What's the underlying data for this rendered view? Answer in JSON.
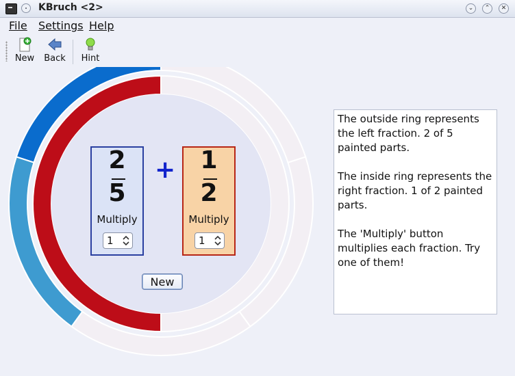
{
  "window": {
    "title": "KBruch <2>"
  },
  "menu": {
    "file": "File",
    "settings": "Settings",
    "help": "Help"
  },
  "toolbar": {
    "new_label": "New",
    "back_label": "Back",
    "hint_label": "Hint"
  },
  "exercise": {
    "left": {
      "numerator": "2",
      "denominator": "5",
      "multiply_label": "Multiply",
      "multiplier": "1",
      "color": "#dbe3f6",
      "border": "#2a3fa0"
    },
    "operator": "+",
    "right": {
      "numerator": "1",
      "denominator": "2",
      "multiply_label": "Multiply",
      "multiplier": "1",
      "color": "#f8d3a6",
      "border": "#b72515"
    },
    "new_button": "New"
  },
  "rings": {
    "outer": {
      "parts": 5,
      "painted": 2,
      "colors": [
        "#0a6ccd",
        "#3e9bd0"
      ],
      "empty": "#f3eff4"
    },
    "inner": {
      "parts": 2,
      "painted": 1,
      "color": "#bd0d18",
      "empty": "#f3eff4"
    }
  },
  "explanation": {
    "p1": "The outside ring represents the left fraction. 2 of 5 painted parts.",
    "p2": "The inside ring represents the right fraction. 1 of 2 painted parts.",
    "p3": "The 'Multiply' button multiplies each fraction. Try one of them!"
  }
}
